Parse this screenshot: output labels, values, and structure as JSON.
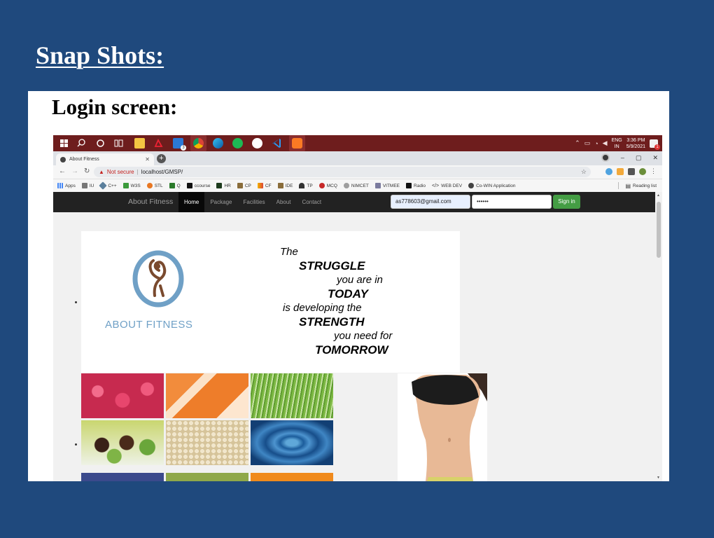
{
  "slide": {
    "title": "Snap Shots:",
    "heading": "Login screen:"
  },
  "taskbar": {
    "icons": [
      "windows-start",
      "search",
      "cortana",
      "task-view",
      "file-explorer",
      "acrobat",
      "mail",
      "chrome",
      "edge",
      "spotify",
      "signal",
      "vscode",
      "xampp"
    ],
    "mail_badge": "3",
    "tray": {
      "lang_top": "ENG",
      "lang_bottom": "IN",
      "time": "3:36 PM",
      "date": "5/9/2021",
      "notification_count": "1"
    }
  },
  "browser": {
    "tab_title": "About Fitness",
    "tab_close": "✕",
    "new_tab": "+",
    "window_controls": {
      "minimize": "–",
      "maximize": "▢",
      "close": "✕"
    },
    "security_label": "Not secure",
    "url": "localhost/GMSP/",
    "bookmarks": [
      "Apps",
      "IU",
      "C++",
      "W3S",
      "STL",
      "Q",
      "ccourse",
      "HR",
      "CP",
      "CF",
      "IDE",
      "TP",
      "MCQ",
      "NIMCET",
      "VITMEE",
      "Radio",
      "WEB DEV",
      "Co-WIN Application"
    ],
    "reading_list": "Reading list"
  },
  "site": {
    "brand": "About Fitness",
    "nav": [
      "Home",
      "Package",
      "Facilities",
      "About",
      "Contact"
    ],
    "active_nav": "Home",
    "email_value": "as778603@gmail.com",
    "password_mask": "••••••",
    "signin_label": "Sign in",
    "logo_text": "ABOUT FITNESS",
    "quote": [
      "The",
      "STRUGGLE",
      "you are in",
      "TODAY",
      "is developing the",
      "STRENGTH",
      "you need for",
      "TOMORROW"
    ]
  },
  "colors": {
    "slide_bg": "#1f497d",
    "taskbar": "#6e1d1d",
    "navbar": "#222222",
    "signin": "#449d44",
    "logo": "#6fa0c6"
  }
}
